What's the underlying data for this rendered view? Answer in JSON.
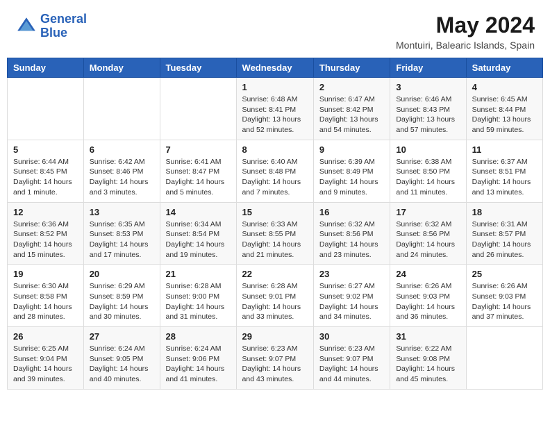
{
  "header": {
    "logo_line1": "General",
    "logo_line2": "Blue",
    "month_year": "May 2024",
    "location": "Montuiri, Balearic Islands, Spain"
  },
  "weekdays": [
    "Sunday",
    "Monday",
    "Tuesday",
    "Wednesday",
    "Thursday",
    "Friday",
    "Saturday"
  ],
  "weeks": [
    [
      {
        "day": "",
        "info": ""
      },
      {
        "day": "",
        "info": ""
      },
      {
        "day": "",
        "info": ""
      },
      {
        "day": "1",
        "info": "Sunrise: 6:48 AM\nSunset: 8:41 PM\nDaylight: 13 hours\nand 52 minutes."
      },
      {
        "day": "2",
        "info": "Sunrise: 6:47 AM\nSunset: 8:42 PM\nDaylight: 13 hours\nand 54 minutes."
      },
      {
        "day": "3",
        "info": "Sunrise: 6:46 AM\nSunset: 8:43 PM\nDaylight: 13 hours\nand 57 minutes."
      },
      {
        "day": "4",
        "info": "Sunrise: 6:45 AM\nSunset: 8:44 PM\nDaylight: 13 hours\nand 59 minutes."
      }
    ],
    [
      {
        "day": "5",
        "info": "Sunrise: 6:44 AM\nSunset: 8:45 PM\nDaylight: 14 hours\nand 1 minute."
      },
      {
        "day": "6",
        "info": "Sunrise: 6:42 AM\nSunset: 8:46 PM\nDaylight: 14 hours\nand 3 minutes."
      },
      {
        "day": "7",
        "info": "Sunrise: 6:41 AM\nSunset: 8:47 PM\nDaylight: 14 hours\nand 5 minutes."
      },
      {
        "day": "8",
        "info": "Sunrise: 6:40 AM\nSunset: 8:48 PM\nDaylight: 14 hours\nand 7 minutes."
      },
      {
        "day": "9",
        "info": "Sunrise: 6:39 AM\nSunset: 8:49 PM\nDaylight: 14 hours\nand 9 minutes."
      },
      {
        "day": "10",
        "info": "Sunrise: 6:38 AM\nSunset: 8:50 PM\nDaylight: 14 hours\nand 11 minutes."
      },
      {
        "day": "11",
        "info": "Sunrise: 6:37 AM\nSunset: 8:51 PM\nDaylight: 14 hours\nand 13 minutes."
      }
    ],
    [
      {
        "day": "12",
        "info": "Sunrise: 6:36 AM\nSunset: 8:52 PM\nDaylight: 14 hours\nand 15 minutes."
      },
      {
        "day": "13",
        "info": "Sunrise: 6:35 AM\nSunset: 8:53 PM\nDaylight: 14 hours\nand 17 minutes."
      },
      {
        "day": "14",
        "info": "Sunrise: 6:34 AM\nSunset: 8:54 PM\nDaylight: 14 hours\nand 19 minutes."
      },
      {
        "day": "15",
        "info": "Sunrise: 6:33 AM\nSunset: 8:55 PM\nDaylight: 14 hours\nand 21 minutes."
      },
      {
        "day": "16",
        "info": "Sunrise: 6:32 AM\nSunset: 8:56 PM\nDaylight: 14 hours\nand 23 minutes."
      },
      {
        "day": "17",
        "info": "Sunrise: 6:32 AM\nSunset: 8:56 PM\nDaylight: 14 hours\nand 24 minutes."
      },
      {
        "day": "18",
        "info": "Sunrise: 6:31 AM\nSunset: 8:57 PM\nDaylight: 14 hours\nand 26 minutes."
      }
    ],
    [
      {
        "day": "19",
        "info": "Sunrise: 6:30 AM\nSunset: 8:58 PM\nDaylight: 14 hours\nand 28 minutes."
      },
      {
        "day": "20",
        "info": "Sunrise: 6:29 AM\nSunset: 8:59 PM\nDaylight: 14 hours\nand 30 minutes."
      },
      {
        "day": "21",
        "info": "Sunrise: 6:28 AM\nSunset: 9:00 PM\nDaylight: 14 hours\nand 31 minutes."
      },
      {
        "day": "22",
        "info": "Sunrise: 6:28 AM\nSunset: 9:01 PM\nDaylight: 14 hours\nand 33 minutes."
      },
      {
        "day": "23",
        "info": "Sunrise: 6:27 AM\nSunset: 9:02 PM\nDaylight: 14 hours\nand 34 minutes."
      },
      {
        "day": "24",
        "info": "Sunrise: 6:26 AM\nSunset: 9:03 PM\nDaylight: 14 hours\nand 36 minutes."
      },
      {
        "day": "25",
        "info": "Sunrise: 6:26 AM\nSunset: 9:03 PM\nDaylight: 14 hours\nand 37 minutes."
      }
    ],
    [
      {
        "day": "26",
        "info": "Sunrise: 6:25 AM\nSunset: 9:04 PM\nDaylight: 14 hours\nand 39 minutes."
      },
      {
        "day": "27",
        "info": "Sunrise: 6:24 AM\nSunset: 9:05 PM\nDaylight: 14 hours\nand 40 minutes."
      },
      {
        "day": "28",
        "info": "Sunrise: 6:24 AM\nSunset: 9:06 PM\nDaylight: 14 hours\nand 41 minutes."
      },
      {
        "day": "29",
        "info": "Sunrise: 6:23 AM\nSunset: 9:07 PM\nDaylight: 14 hours\nand 43 minutes."
      },
      {
        "day": "30",
        "info": "Sunrise: 6:23 AM\nSunset: 9:07 PM\nDaylight: 14 hours\nand 44 minutes."
      },
      {
        "day": "31",
        "info": "Sunrise: 6:22 AM\nSunset: 9:08 PM\nDaylight: 14 hours\nand 45 minutes."
      },
      {
        "day": "",
        "info": ""
      }
    ]
  ]
}
